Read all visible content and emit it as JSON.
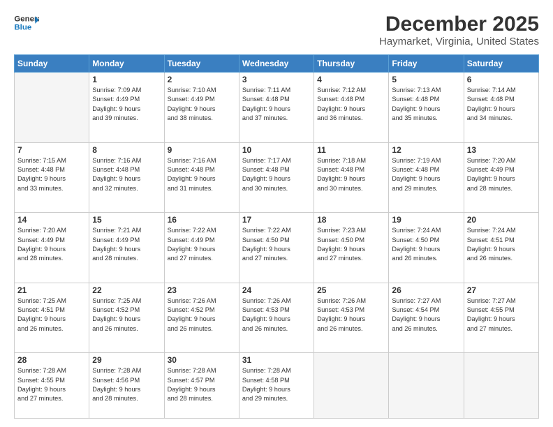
{
  "logo": {
    "line1": "General",
    "line2": "Blue"
  },
  "title": "December 2025",
  "subtitle": "Haymarket, Virginia, United States",
  "weekdays": [
    "Sunday",
    "Monday",
    "Tuesday",
    "Wednesday",
    "Thursday",
    "Friday",
    "Saturday"
  ],
  "weeks": [
    [
      {
        "day": "",
        "info": ""
      },
      {
        "day": "1",
        "info": "Sunrise: 7:09 AM\nSunset: 4:49 PM\nDaylight: 9 hours\nand 39 minutes."
      },
      {
        "day": "2",
        "info": "Sunrise: 7:10 AM\nSunset: 4:49 PM\nDaylight: 9 hours\nand 38 minutes."
      },
      {
        "day": "3",
        "info": "Sunrise: 7:11 AM\nSunset: 4:48 PM\nDaylight: 9 hours\nand 37 minutes."
      },
      {
        "day": "4",
        "info": "Sunrise: 7:12 AM\nSunset: 4:48 PM\nDaylight: 9 hours\nand 36 minutes."
      },
      {
        "day": "5",
        "info": "Sunrise: 7:13 AM\nSunset: 4:48 PM\nDaylight: 9 hours\nand 35 minutes."
      },
      {
        "day": "6",
        "info": "Sunrise: 7:14 AM\nSunset: 4:48 PM\nDaylight: 9 hours\nand 34 minutes."
      }
    ],
    [
      {
        "day": "7",
        "info": "Sunrise: 7:15 AM\nSunset: 4:48 PM\nDaylight: 9 hours\nand 33 minutes."
      },
      {
        "day": "8",
        "info": "Sunrise: 7:16 AM\nSunset: 4:48 PM\nDaylight: 9 hours\nand 32 minutes."
      },
      {
        "day": "9",
        "info": "Sunrise: 7:16 AM\nSunset: 4:48 PM\nDaylight: 9 hours\nand 31 minutes."
      },
      {
        "day": "10",
        "info": "Sunrise: 7:17 AM\nSunset: 4:48 PM\nDaylight: 9 hours\nand 30 minutes."
      },
      {
        "day": "11",
        "info": "Sunrise: 7:18 AM\nSunset: 4:48 PM\nDaylight: 9 hours\nand 30 minutes."
      },
      {
        "day": "12",
        "info": "Sunrise: 7:19 AM\nSunset: 4:48 PM\nDaylight: 9 hours\nand 29 minutes."
      },
      {
        "day": "13",
        "info": "Sunrise: 7:20 AM\nSunset: 4:49 PM\nDaylight: 9 hours\nand 28 minutes."
      }
    ],
    [
      {
        "day": "14",
        "info": "Sunrise: 7:20 AM\nSunset: 4:49 PM\nDaylight: 9 hours\nand 28 minutes."
      },
      {
        "day": "15",
        "info": "Sunrise: 7:21 AM\nSunset: 4:49 PM\nDaylight: 9 hours\nand 28 minutes."
      },
      {
        "day": "16",
        "info": "Sunrise: 7:22 AM\nSunset: 4:49 PM\nDaylight: 9 hours\nand 27 minutes."
      },
      {
        "day": "17",
        "info": "Sunrise: 7:22 AM\nSunset: 4:50 PM\nDaylight: 9 hours\nand 27 minutes."
      },
      {
        "day": "18",
        "info": "Sunrise: 7:23 AM\nSunset: 4:50 PM\nDaylight: 9 hours\nand 27 minutes."
      },
      {
        "day": "19",
        "info": "Sunrise: 7:24 AM\nSunset: 4:50 PM\nDaylight: 9 hours\nand 26 minutes."
      },
      {
        "day": "20",
        "info": "Sunrise: 7:24 AM\nSunset: 4:51 PM\nDaylight: 9 hours\nand 26 minutes."
      }
    ],
    [
      {
        "day": "21",
        "info": "Sunrise: 7:25 AM\nSunset: 4:51 PM\nDaylight: 9 hours\nand 26 minutes."
      },
      {
        "day": "22",
        "info": "Sunrise: 7:25 AM\nSunset: 4:52 PM\nDaylight: 9 hours\nand 26 minutes."
      },
      {
        "day": "23",
        "info": "Sunrise: 7:26 AM\nSunset: 4:52 PM\nDaylight: 9 hours\nand 26 minutes."
      },
      {
        "day": "24",
        "info": "Sunrise: 7:26 AM\nSunset: 4:53 PM\nDaylight: 9 hours\nand 26 minutes."
      },
      {
        "day": "25",
        "info": "Sunrise: 7:26 AM\nSunset: 4:53 PM\nDaylight: 9 hours\nand 26 minutes."
      },
      {
        "day": "26",
        "info": "Sunrise: 7:27 AM\nSunset: 4:54 PM\nDaylight: 9 hours\nand 26 minutes."
      },
      {
        "day": "27",
        "info": "Sunrise: 7:27 AM\nSunset: 4:55 PM\nDaylight: 9 hours\nand 27 minutes."
      }
    ],
    [
      {
        "day": "28",
        "info": "Sunrise: 7:28 AM\nSunset: 4:55 PM\nDaylight: 9 hours\nand 27 minutes."
      },
      {
        "day": "29",
        "info": "Sunrise: 7:28 AM\nSunset: 4:56 PM\nDaylight: 9 hours\nand 28 minutes."
      },
      {
        "day": "30",
        "info": "Sunrise: 7:28 AM\nSunset: 4:57 PM\nDaylight: 9 hours\nand 28 minutes."
      },
      {
        "day": "31",
        "info": "Sunrise: 7:28 AM\nSunset: 4:58 PM\nDaylight: 9 hours\nand 29 minutes."
      },
      {
        "day": "",
        "info": ""
      },
      {
        "day": "",
        "info": ""
      },
      {
        "day": "",
        "info": ""
      }
    ]
  ]
}
